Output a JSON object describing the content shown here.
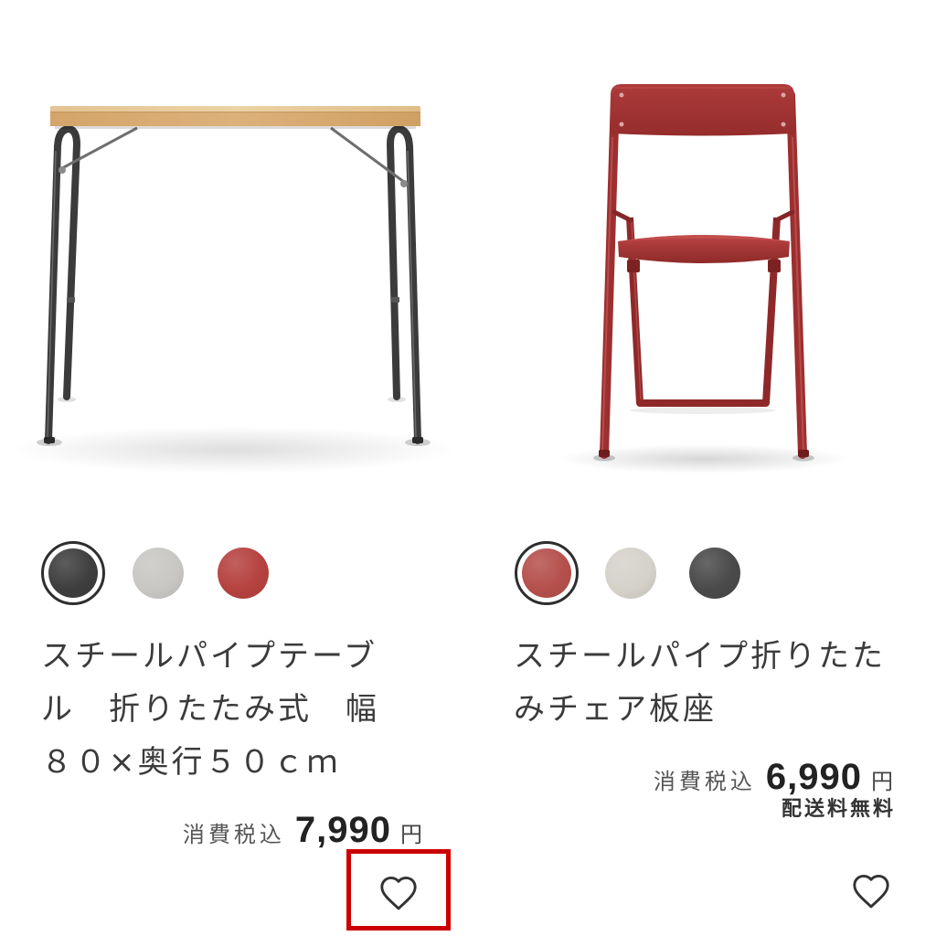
{
  "products": [
    {
      "name": "スチールパイプテーブル　折りたたみ式　幅８０×奥行５０ｃｍ",
      "swatches": [
        {
          "color": "#3e3e3e",
          "selected": true
        },
        {
          "color": "#c9c7c4",
          "selected": false
        },
        {
          "color": "#b5423f",
          "selected": false
        }
      ],
      "tax_label": "消費税込",
      "price": "7,990",
      "currency": "円",
      "favorite_icon": "heart-outline-icon"
    },
    {
      "name": "スチールパイプ折りたたみチェア板座",
      "swatches": [
        {
          "color": "#b5504c",
          "selected": true
        },
        {
          "color": "#d5d2ca",
          "selected": false
        },
        {
          "color": "#4a4a4a",
          "selected": false
        }
      ],
      "tax_label": "消費税込",
      "price": "6,990",
      "currency": "円",
      "shipping_note": "配送料無料",
      "favorite_icon": "heart-outline-icon"
    }
  ],
  "highlight_box": {
    "color": "#cc0000"
  }
}
